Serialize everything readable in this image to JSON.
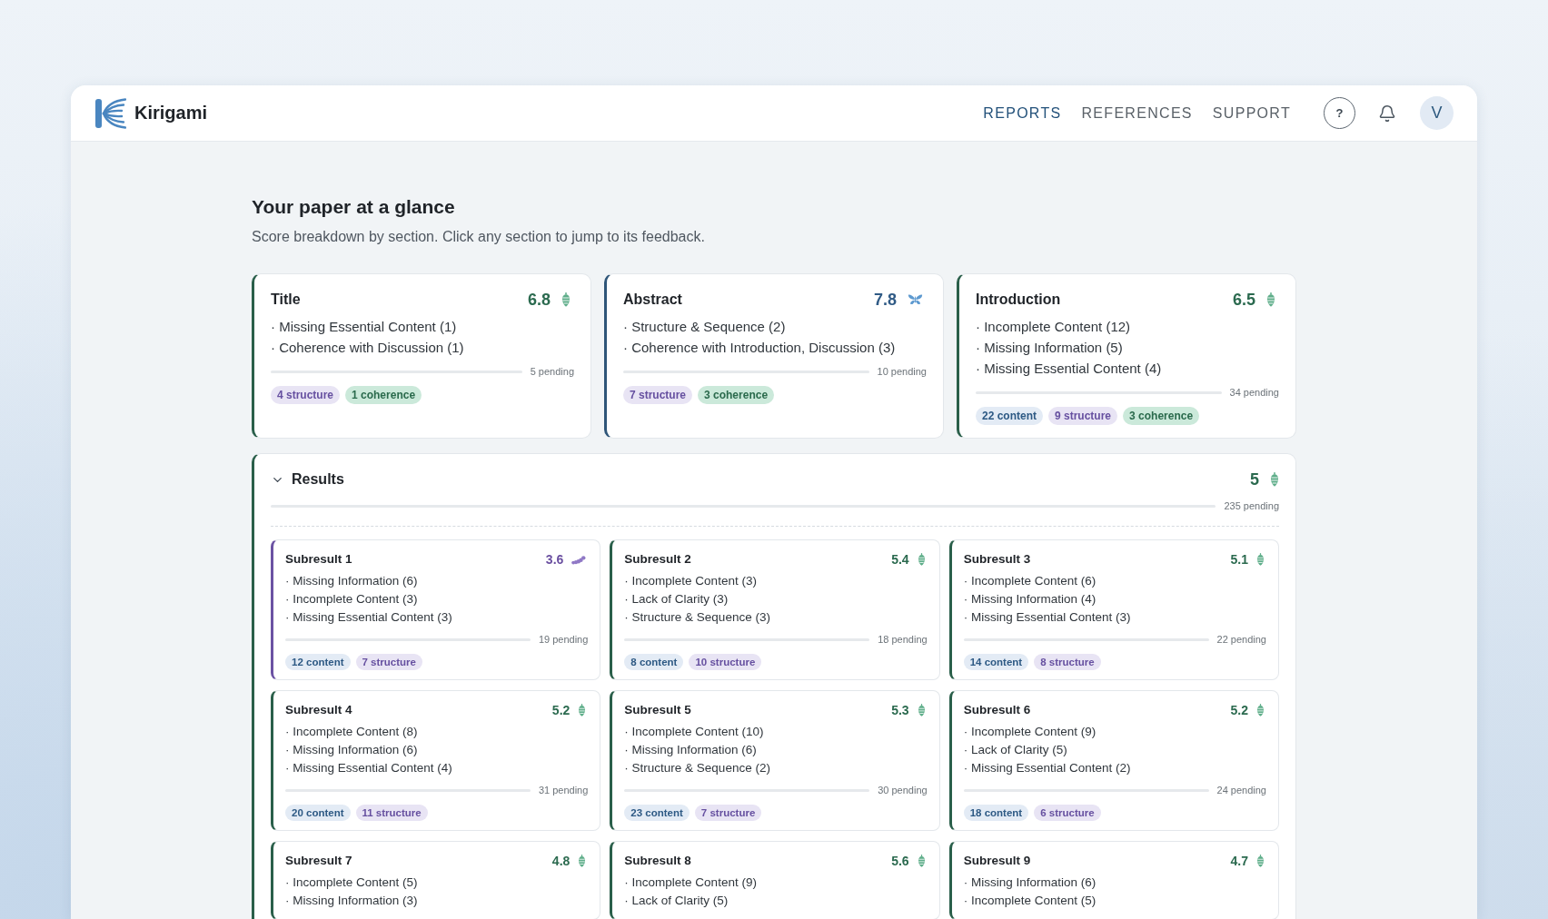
{
  "brand": {
    "name": "Kirigami"
  },
  "nav": [
    {
      "label": "REPORTS",
      "selected": true
    },
    {
      "label": "REFERENCES",
      "selected": false
    },
    {
      "label": "SUPPORT",
      "selected": false
    }
  ],
  "header_actions": {
    "help_label": "?",
    "avatar_initial": "V"
  },
  "overview": {
    "title": "Your paper at a glance",
    "subtitle": "Score breakdown by section. Click any section to jump to its feedback."
  },
  "sections": [
    {
      "title": "Title",
      "score": "6.8",
      "kind": "cocoon",
      "issues": [
        "· Missing Essential Content (1)",
        "· Coherence with Discussion (1)"
      ],
      "pending": "5 pending",
      "tags": [
        {
          "label": "4 structure",
          "kind": "structure"
        },
        {
          "label": "1 coherence",
          "kind": "coherence"
        }
      ]
    },
    {
      "title": "Abstract",
      "score": "7.8",
      "kind": "butterfly",
      "issues": [
        "· Structure & Sequence (2)",
        "· Coherence with Introduction, Discussion (3)"
      ],
      "pending": "10 pending",
      "tags": [
        {
          "label": "7 structure",
          "kind": "structure"
        },
        {
          "label": "3 coherence",
          "kind": "coherence"
        }
      ]
    },
    {
      "title": "Introduction",
      "score": "6.5",
      "kind": "cocoon",
      "issues": [
        "· Incomplete Content (12)",
        "· Missing Information (5)",
        "· Missing Essential Content (4)"
      ],
      "pending": "34 pending",
      "tags": [
        {
          "label": "22 content",
          "kind": "content"
        },
        {
          "label": "9 structure",
          "kind": "structure"
        },
        {
          "label": "3 coherence",
          "kind": "coherence"
        }
      ]
    }
  ],
  "results": {
    "title": "Results",
    "expanded": true,
    "score": "5",
    "kind": "cocoon",
    "pending": "235 pending",
    "subresults": [
      {
        "title": "Subresult 1",
        "score": "3.6",
        "kind": "caterpillar",
        "issues": [
          "· Missing Information (6)",
          "· Incomplete Content (3)",
          "· Missing Essential Content (3)"
        ],
        "pending": "19 pending",
        "tags": [
          {
            "label": "12 content",
            "kind": "content"
          },
          {
            "label": "7 structure",
            "kind": "structure"
          }
        ]
      },
      {
        "title": "Subresult 2",
        "score": "5.4",
        "kind": "cocoon",
        "issues": [
          "· Incomplete Content (3)",
          "· Lack of Clarity (3)",
          "· Structure & Sequence (3)"
        ],
        "pending": "18 pending",
        "tags": [
          {
            "label": "8 content",
            "kind": "content"
          },
          {
            "label": "10 structure",
            "kind": "structure"
          }
        ]
      },
      {
        "title": "Subresult 3",
        "score": "5.1",
        "kind": "cocoon",
        "issues": [
          "· Incomplete Content (6)",
          "· Missing Information (4)",
          "· Missing Essential Content (3)"
        ],
        "pending": "22 pending",
        "tags": [
          {
            "label": "14 content",
            "kind": "content"
          },
          {
            "label": "8 structure",
            "kind": "structure"
          }
        ]
      },
      {
        "title": "Subresult 4",
        "score": "5.2",
        "kind": "cocoon",
        "issues": [
          "· Incomplete Content (8)",
          "· Missing Information (6)",
          "· Missing Essential Content (4)"
        ],
        "pending": "31 pending",
        "tags": [
          {
            "label": "20 content",
            "kind": "content"
          },
          {
            "label": "11 structure",
            "kind": "structure"
          }
        ]
      },
      {
        "title": "Subresult 5",
        "score": "5.3",
        "kind": "cocoon",
        "issues": [
          "· Incomplete Content (10)",
          "· Missing Information (6)",
          "· Structure & Sequence (2)"
        ],
        "pending": "30 pending",
        "tags": [
          {
            "label": "23 content",
            "kind": "content"
          },
          {
            "label": "7 structure",
            "kind": "structure"
          }
        ]
      },
      {
        "title": "Subresult 6",
        "score": "5.2",
        "kind": "cocoon",
        "issues": [
          "· Incomplete Content (9)",
          "· Lack of Clarity (5)",
          "· Missing Essential Content (2)"
        ],
        "pending": "24 pending",
        "tags": [
          {
            "label": "18 content",
            "kind": "content"
          },
          {
            "label": "6 structure",
            "kind": "structure"
          }
        ]
      },
      {
        "title": "Subresult 7",
        "score": "4.8",
        "kind": "cocoon",
        "issues": [
          "· Incomplete Content (5)",
          "· Missing Information (3)"
        ]
      },
      {
        "title": "Subresult 8",
        "score": "5.6",
        "kind": "cocoon",
        "issues": [
          "· Incomplete Content (9)",
          "· Lack of Clarity (5)"
        ]
      },
      {
        "title": "Subresult 9",
        "score": "4.7",
        "kind": "cocoon",
        "issues": [
          "· Missing Information (6)",
          "· Incomplete Content (5)"
        ]
      }
    ]
  }
}
